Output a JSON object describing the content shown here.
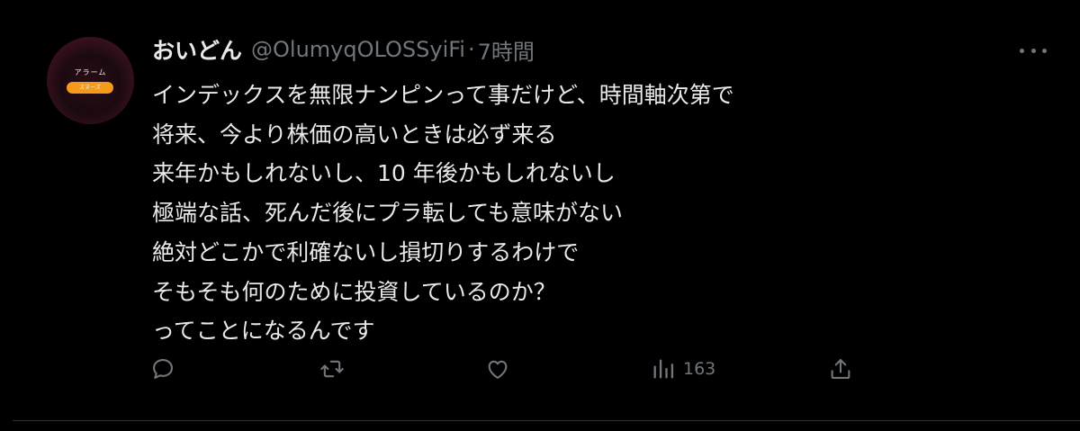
{
  "tweet": {
    "author_name": "おいどん",
    "handle": "@OlumyqOLOSSyiFi",
    "separator": "·",
    "timestamp": "7時間",
    "avatar": {
      "label": "アラーム",
      "button_label": "スヌーズ"
    },
    "text_lines": [
      "インデックスを無限ナンピンって事だけど、時間軸次第で",
      "将来、今より株価の高いときは必ず来る",
      "来年かもしれないし、10 年後かもしれないし",
      "極端な話、死んだ後にプラ転しても意味がない",
      "絶対どこかで利確ないし損切りするわけで",
      "そもそも何のために投資しているのか？",
      "ってことになるんです"
    ],
    "actions": {
      "reply_icon": "reply-icon",
      "retweet_icon": "retweet-icon",
      "like_icon": "heart-icon",
      "views_icon": "views-icon",
      "views_count": "163",
      "share_icon": "share-icon"
    }
  },
  "colors": {
    "background": "#000000",
    "primary_text": "#e7e9ea",
    "secondary_text": "#71767b",
    "divider": "#2f3336",
    "avatar_accent": "#f59a1a"
  }
}
